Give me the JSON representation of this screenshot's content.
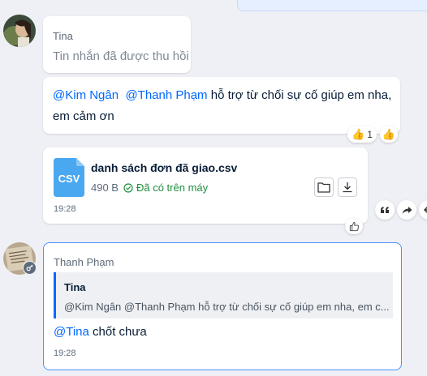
{
  "messages": {
    "recalled": {
      "sender": "Tina",
      "text": "Tin nhắn đã được thu hồi"
    },
    "support": {
      "mention1": "@Kim Ngân",
      "mention2": "@Thanh Phạm",
      "text_line1": " hỗ trợ từ chối sự cố giúp em nha,",
      "text_line2": "em cảm ơn",
      "reaction_count": "1"
    },
    "file": {
      "badge": "CSV",
      "name": "danh sách đơn đã giao.csv",
      "size": "490 B",
      "status": "Đã có trên máy",
      "time": "19:28"
    },
    "reply": {
      "sender": "Thanh Phạm",
      "quote_author": "Tina",
      "quote_text": "@Kim Ngân @Thanh Phạm hỗ trợ từ chối sự cố giúp em nha, em c...",
      "mention": "@Tina",
      "text": " chốt chưa",
      "time": "19:28"
    }
  },
  "colors": {
    "accent": "#0068ff",
    "background": "#eef0f5",
    "success": "#1e8e3e",
    "csv_badge": "#4aa8f0"
  },
  "icons": [
    "thumbs-up-icon",
    "folder-icon",
    "download-icon",
    "quote-icon",
    "share-icon",
    "more-icon",
    "check-circle-icon",
    "key-icon"
  ]
}
